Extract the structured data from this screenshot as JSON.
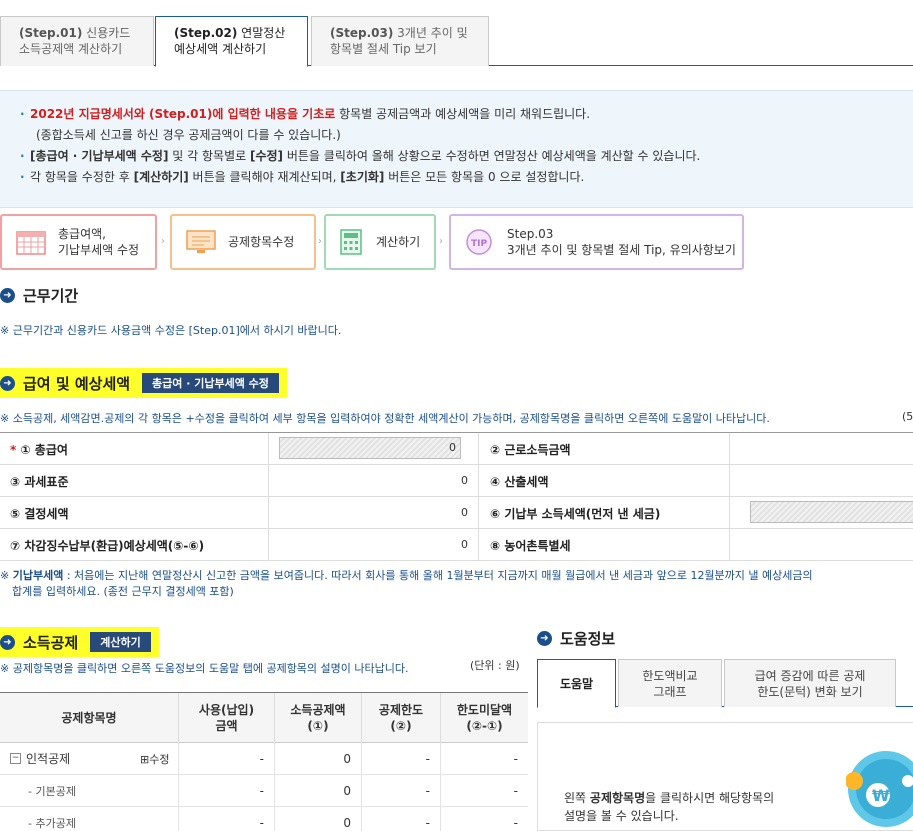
{
  "tabs": [
    {
      "step": "(Step.01)",
      "title": "신용카드",
      "line2": "소득공제액 계산하기"
    },
    {
      "step": "(Step.02)",
      "title": "연말정산",
      "line2": "예상세액 계산하기"
    },
    {
      "step": "(Step.03)",
      "title": "3개년 추이 및",
      "line2": "항목별 절세 Tip 보기"
    }
  ],
  "info": {
    "l1_red": "2022년 지급명세서와 (Step.01)에 입력한 내용을 기초로",
    "l1_rest": " 항목별 공제금액과 예상세액을 미리 채워드립니다.",
    "l1_sub": "(종합소득세 신고를 하신 경우 공제금액이 다를 수 있습니다.)",
    "l2_b1": "[총급여 · 기납부세액 수정]",
    "l2_t1": " 및 각 항목별로 ",
    "l2_b2": "[수정]",
    "l2_t2": " 버튼을 클릭하여 올해 상황으로 수정하면 연말정산 예상세액을 계산할 수 있습니다.",
    "l3_t1": "각 항목을 수정한 후 ",
    "l3_b1": "[계산하기]",
    "l3_t2": " 버튼을 클릭해야 재계산되며, ",
    "l3_b2": "[초기화]",
    "l3_t3": " 버튼은 모든 항목을 0 으로 설정합니다."
  },
  "steps": [
    {
      "label1": "총급여액,",
      "label2": "기납부세액 수정",
      "color": "#f2a0a0"
    },
    {
      "label1": "공제항목수정",
      "label2": "",
      "color": "#f5c08a"
    },
    {
      "label1": "계산하기",
      "label2": "",
      "color": "#9fdcb3"
    },
    {
      "label1": "Step.03",
      "label2": "3개년 추이 및 항목별 절세 Tip, 유의사항보기",
      "color": "#d2b4e6",
      "icon_text": "TIP"
    }
  ],
  "work_period": {
    "title": "근무기간",
    "note": "※ 근무기간과 신용카드 사용금액 수정은 [Step.01]에서 하시기 바랍니다."
  },
  "salary": {
    "title": "급여 및 예상세액",
    "button": "총급여 · 기납부세액 수정",
    "note": "※ 소득공제, 세액감면.공제의 각 항목은 +수정을 클릭하여 세부 항목을 입력하여야 정확한 세액계산이 가능하며, 공제항목명을 클릭하면 오른쪽에 도움말이 나타납니다.",
    "unit_cut": "(5",
    "rows": [
      {
        "label": "① 총급여",
        "required": "*",
        "value": "0",
        "label2": "② 근로소득금액"
      },
      {
        "label": "③ 과세표준",
        "value": "0",
        "label2": "④ 산출세액"
      },
      {
        "label": "⑤ 결정세액",
        "value": "0",
        "label2": "⑥ 기납부 소득세액(먼저 낸 세금)"
      },
      {
        "label": "⑦ 차감징수납부(환급)예상세액(⑤-⑥)",
        "value": "0",
        "label2": "⑧ 농어촌특별세"
      }
    ],
    "prepaid_note_bold": "기납부세액",
    "prepaid_note": " : 처음에는 지난해 연말정산시 신고한 금액을 보여줍니다. 따라서 회사를 통해 올해 1월분부터 지금까지 매월 월급에서 낸 세금과 앞으로 12월분까지 낼 예상세금의",
    "prepaid_note2": "합계를 입력하세요. (종전 근무지 결정세액 포함)",
    "prepaid_prefix": "※ "
  },
  "income_deduction": {
    "title": "소득공제",
    "button": "계산하기",
    "note": "※ 공제항목명을 클릭하면 오른쪽 도움정보의 도움말 탭에 공제항목의 설명이 나타납니다.",
    "unit": "(단위 : 원)",
    "headers": [
      "공제항목명",
      "사용(납입)\n금액",
      "소득공제액\n(①)",
      "공제한도\n(②)",
      "한도미달액\n(②-①)"
    ],
    "rows": [
      {
        "name": "인적공제",
        "expander": "−",
        "edit": "⊞수정",
        "used": "-",
        "deduct": "0",
        "limit": "-",
        "under": "-"
      },
      {
        "name": "- 기본공제",
        "used": "-",
        "deduct": "0",
        "limit": "-",
        "under": "-"
      },
      {
        "name": "- 추가공제",
        "used": "-",
        "deduct": "0",
        "limit": "-",
        "under": "-"
      }
    ]
  },
  "help": {
    "title": "도움정보",
    "tabs": [
      "도움말",
      "한도액비교\n그래프",
      "급여 증감에 따른 공제\n한도(문턱) 변화 보기"
    ],
    "text1_pre": "왼쪽 ",
    "text1_bold": "공제항목명",
    "text1_post": "을 클릭하시면 해당항목의",
    "text2": "설명을 볼 수 있습니다."
  }
}
